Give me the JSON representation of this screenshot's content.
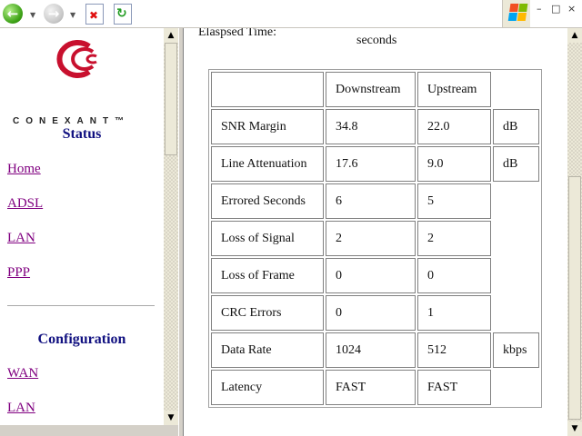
{
  "toolbar": {
    "back_icon": "back-arrow-icon",
    "forward_icon": "forward-arrow-icon",
    "stop_icon": "stop-icon",
    "refresh_icon": "refresh-icon"
  },
  "window_controls": {
    "minimize": "–",
    "maximize": "□",
    "close": "×"
  },
  "left": {
    "brand": "CONEXANT™",
    "status_title": "Status",
    "status_links": [
      "Home",
      "ADSL",
      "LAN",
      "PPP"
    ],
    "config_title": "Configuration",
    "config_links": [
      "WAN",
      "LAN"
    ]
  },
  "main": {
    "elapsed_label": "Elaspsed Time:",
    "elapsed_unit": "seconds",
    "headers": [
      "Downstream",
      "Upstream"
    ],
    "rows": [
      {
        "label": "SNR Margin",
        "down": "34.8",
        "up": "22.0",
        "unit": "dB"
      },
      {
        "label": "Line Attenuation",
        "down": "17.6",
        "up": "9.0",
        "unit": "dB"
      },
      {
        "label": "Errored Seconds",
        "down": "6",
        "up": "5",
        "unit": ""
      },
      {
        "label": "Loss of Signal",
        "down": "2",
        "up": "2",
        "unit": ""
      },
      {
        "label": "Loss of Frame",
        "down": "0",
        "up": "0",
        "unit": ""
      },
      {
        "label": "CRC Errors",
        "down": "0",
        "up": "1",
        "unit": ""
      },
      {
        "label": "Data Rate",
        "down": "1024",
        "up": "512",
        "unit": "kbps"
      },
      {
        "label": "Latency",
        "down": "FAST",
        "up": "FAST",
        "unit": ""
      }
    ]
  },
  "colors": {
    "link_visited": "#800080",
    "title": "#101080",
    "logo_red": "#c8102e"
  }
}
